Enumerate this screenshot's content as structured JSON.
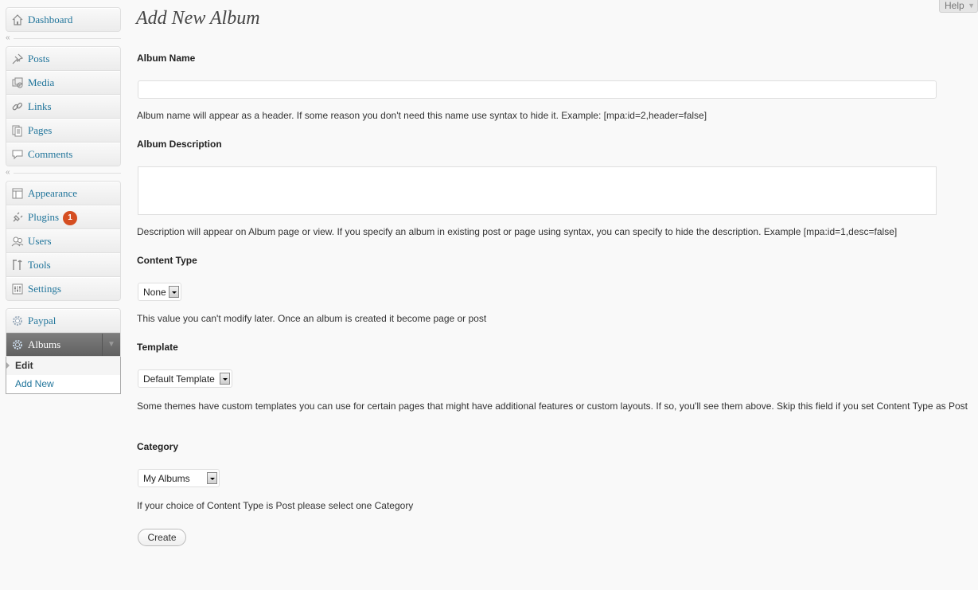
{
  "help_tab": {
    "label": "Help"
  },
  "sidebar": {
    "groups": [
      {
        "items": [
          {
            "label": "Dashboard",
            "icon": "dashboard-icon"
          }
        ]
      },
      {
        "items": [
          {
            "label": "Posts",
            "icon": "pushpin-icon"
          },
          {
            "label": "Media",
            "icon": "media-icon"
          },
          {
            "label": "Links",
            "icon": "link-icon"
          },
          {
            "label": "Pages",
            "icon": "pages-icon"
          },
          {
            "label": "Comments",
            "icon": "comment-icon"
          }
        ]
      },
      {
        "items": [
          {
            "label": "Appearance",
            "icon": "appearance-icon"
          },
          {
            "label": "Plugins",
            "icon": "plugin-icon",
            "badge": "1"
          },
          {
            "label": "Users",
            "icon": "users-icon"
          },
          {
            "label": "Tools",
            "icon": "tools-icon"
          },
          {
            "label": "Settings",
            "icon": "settings-icon"
          }
        ]
      },
      {
        "items": [
          {
            "label": "Paypal",
            "icon": "gear-icon"
          },
          {
            "label": "Albums",
            "icon": "gear-icon",
            "current": true
          }
        ]
      }
    ],
    "albums_submenu": [
      {
        "label": "Edit",
        "active": true
      },
      {
        "label": "Add New"
      }
    ]
  },
  "page": {
    "title": "Add New Album"
  },
  "form": {
    "album_name": {
      "label": "Album Name",
      "value": "",
      "description": "Album name will appear as a header. If some reason you don't need this name use syntax to hide it. Example: [mpa:id=2,header=false]"
    },
    "album_description": {
      "label": "Album Description",
      "value": "",
      "description": "Description will appear on Album page or view. If you specify an album in existing post or page using syntax, you can specify to hide the description. Example [mpa:id=1,desc=false]"
    },
    "content_type": {
      "label": "Content Type",
      "selected": "None",
      "description": "This value you can't modify later. Once an album is created it become page or post"
    },
    "template": {
      "label": "Template",
      "selected": "Default Template",
      "description": "Some themes have custom templates you can use for certain pages that might have additional features or custom layouts. If so, you'll see them above. Skip this field if you set Content Type as Post"
    },
    "category": {
      "label": "Category",
      "selected": "My Albums",
      "description": "If your choice of Content Type is Post please select one Category"
    },
    "submit_label": "Create"
  },
  "colors": {
    "link": "#21759b",
    "badge": "#d54e21",
    "current_menu": "#6d6d6d"
  }
}
